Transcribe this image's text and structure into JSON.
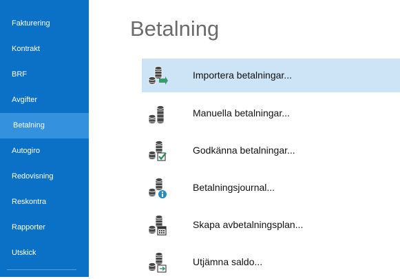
{
  "sidebar": {
    "items": [
      {
        "label": "Fakturering"
      },
      {
        "label": "Kontrakt"
      },
      {
        "label": "BRF"
      },
      {
        "label": "Avgifter"
      },
      {
        "label": "Betalning",
        "selected": true
      },
      {
        "label": "Autogiro"
      },
      {
        "label": "Redovisning"
      },
      {
        "label": "Reskontra"
      },
      {
        "label": "Rapporter"
      },
      {
        "label": "Utskick"
      }
    ]
  },
  "main": {
    "title": "Betalning",
    "actions": [
      {
        "label": "Importera betalningar...",
        "icon": "coins-import-icon",
        "highlighted": true
      },
      {
        "label": "Manuella betalningar...",
        "icon": "coins-icon"
      },
      {
        "label": "Godkänna betalningar...",
        "icon": "coins-approve-icon"
      },
      {
        "label": "Betalningsjournal...",
        "icon": "coins-info-icon"
      },
      {
        "label": "Skapa avbetalningsplan...",
        "icon": "coins-calendar-icon"
      },
      {
        "label": "Utjämna saldo...",
        "icon": "coins-balance-icon"
      }
    ]
  },
  "colors": {
    "sidebar": "#0b71c6",
    "sidebar_selected": "#3391dd",
    "row_highlight": "#cde4f7",
    "coins": "#474747",
    "approve_badge": "#2e8b57",
    "info_badge": "#2b8cc4",
    "import_badge": "#3a9b6e"
  }
}
